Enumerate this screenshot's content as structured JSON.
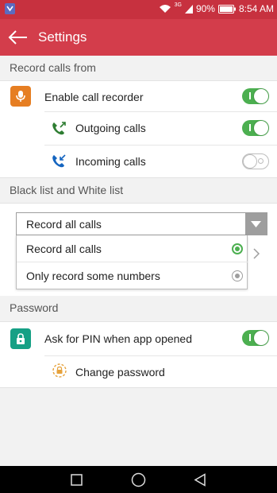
{
  "status_bar": {
    "network": "3G",
    "battery": "90%",
    "time": "8:54 AM"
  },
  "app_bar": {
    "title": "Settings",
    "back_icon": "arrow-left-icon"
  },
  "sections": {
    "record_calls": {
      "header": "Record calls from",
      "enable_label": "Enable call recorder",
      "enable_on": true,
      "outgoing_label": "Outgoing calls",
      "outgoing_on": true,
      "incoming_label": "Incoming calls",
      "incoming_on": false
    },
    "lists": {
      "header": "Black list and White list",
      "selected": "Record all calls",
      "options": [
        "Record all calls",
        "Only record some numbers"
      ]
    },
    "password": {
      "header": "Password",
      "pin_label": "Ask for PIN when app opened",
      "pin_on": true,
      "change_label": "Change password"
    }
  },
  "colors": {
    "status_bar": "#c7313f",
    "app_bar": "#d33d4b",
    "toggle_on": "#4caf50",
    "mic_icon_bg": "#e67e22",
    "lock_icon_bg": "#16a085",
    "outgoing_icon": "#2e7d32",
    "incoming_icon": "#1565c0"
  }
}
